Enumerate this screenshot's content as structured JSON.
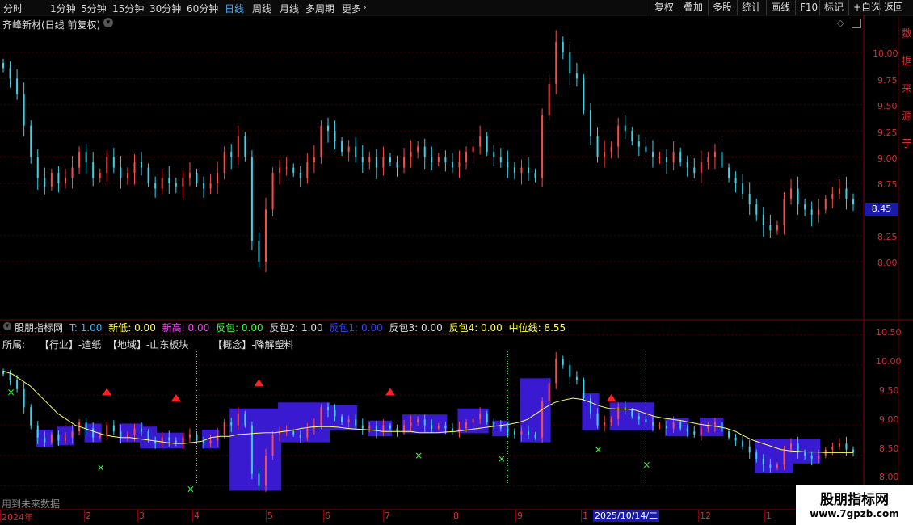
{
  "toolbar": {
    "timeframes": [
      "分时",
      "1分钟",
      "5分钟",
      "15分钟",
      "30分钟",
      "60分钟",
      "日线",
      "周线",
      "月线",
      "多周期",
      "更多"
    ],
    "active": "日线",
    "right_buttons": [
      "复权",
      "叠加",
      "多股",
      "统计",
      "画线",
      "F10",
      "标记",
      "+自选",
      "返回"
    ]
  },
  "main": {
    "title": "齐峰新材(日线 前复权)",
    "price_labels": [
      "10.00",
      "9.75",
      "9.50",
      "9.25",
      "9.00",
      "8.75",
      "8.25",
      "8.00"
    ],
    "current_price": "8.45",
    "right_edge_text": "数据来源于"
  },
  "indicator": {
    "name": "股朋指标网",
    "values": [
      {
        "label": "T: 1.00",
        "color": "#33b8ff"
      },
      {
        "label": "新低: 0.00",
        "color": "#ffff44"
      },
      {
        "label": "新高: 0.00",
        "color": "#ff44ff"
      },
      {
        "label": "反包: 0.00",
        "color": "#33ff33"
      },
      {
        "label": "反包2: 1.00",
        "color": "#dddddd"
      },
      {
        "label": "反包1: 0.00",
        "color": "#3344ff"
      },
      {
        "label": "反包3: 0.00",
        "color": "#dddddd"
      },
      {
        "label": "反包4: 0.00",
        "color": "#ffff44"
      },
      {
        "label": "中位线: 8.55",
        "color": "#ffff44"
      }
    ],
    "belong": "所属:",
    "industry": "【行业】-造纸",
    "region": "【地域】-山东板块",
    "concept": "【概念】-降解塑料",
    "price_labels": [
      "10.50",
      "10.00",
      "9.50",
      "9.00",
      "8.50",
      "8.00"
    ],
    "footnote": "用到未来数据"
  },
  "dates": {
    "labels": [
      "2024年",
      "2",
      "3",
      "4",
      "5",
      "6",
      "7",
      "8",
      "9",
      "1",
      "12",
      "1"
    ],
    "highlight": "2025/10/14/二"
  },
  "watermark": {
    "line1": "股朋指标网",
    "line2": "www.7gpzb.com"
  },
  "colors": {
    "up": "#ff4a4a",
    "down": "#3ad3e8",
    "ma": "#ffff66",
    "band": "#3a1ad0",
    "grid": "#4a0000"
  },
  "chart_data": [
    {
      "type": "candlestick",
      "title": "齐峰新材(日线 前复权)",
      "ylim": [
        7.5,
        10.2
      ],
      "yticks": [
        8.0,
        8.25,
        8.75,
        9.0,
        9.25,
        9.5,
        9.75,
        10.0
      ],
      "last_price": 8.45,
      "close": [
        9.85,
        9.75,
        9.6,
        9.3,
        9.0,
        8.8,
        8.72,
        8.85,
        8.75,
        8.8,
        8.9,
        9.05,
        8.95,
        8.8,
        8.85,
        9.0,
        8.9,
        8.8,
        8.85,
        8.95,
        8.9,
        8.75,
        8.7,
        8.8,
        8.75,
        8.72,
        8.8,
        8.85,
        8.75,
        8.7,
        8.75,
        8.85,
        9.05,
        9.0,
        9.2,
        9.0,
        8.2,
        8.0,
        8.5,
        8.85,
        8.9,
        8.9,
        8.85,
        8.8,
        8.95,
        9.0,
        9.3,
        9.25,
        9.15,
        9.05,
        9.1,
        9.0,
        8.95,
        9.0,
        8.9,
        9.0,
        8.95,
        8.9,
        9.0,
        9.05,
        9.1,
        9.0,
        8.95,
        9.0,
        8.95,
        8.9,
        8.95,
        9.05,
        9.1,
        9.2,
        9.05,
        9.0,
        8.95,
        8.9,
        8.85,
        8.9,
        8.85,
        8.8,
        9.4,
        9.7,
        10.1,
        10.0,
        9.8,
        9.75,
        9.45,
        9.2,
        9.0,
        9.05,
        9.1,
        9.3,
        9.25,
        9.15,
        9.1,
        9.05,
        9.0,
        9.0,
        8.95,
        9.05,
        8.95,
        8.9,
        8.85,
        8.95,
        9.0,
        9.05,
        8.9,
        8.8,
        8.75,
        8.65,
        8.55,
        8.45,
        8.35,
        8.3,
        8.35,
        8.6,
        8.7,
        8.55,
        8.5,
        8.45,
        8.5,
        8.6,
        8.65,
        8.7,
        8.6,
        8.55
      ]
    },
    {
      "type": "line",
      "title": "股朋指标网",
      "ylim": [
        7.9,
        10.6
      ],
      "yticks": [
        8.0,
        8.5,
        9.0,
        9.5,
        10.0,
        10.5
      ],
      "series": [
        {
          "name": "中位线",
          "values": [
            9.9,
            9.85,
            9.75,
            9.65,
            9.5,
            9.35,
            9.2,
            9.1,
            9.0,
            8.95,
            8.9,
            8.85,
            8.82,
            8.8,
            8.8,
            8.78,
            8.76,
            8.74,
            8.72,
            8.7,
            8.7,
            8.72,
            8.74,
            8.8,
            8.82,
            8.82,
            8.85,
            8.86,
            8.87,
            8.88,
            8.88,
            8.9,
            8.92,
            8.95,
            8.97,
            8.98,
            8.98,
            8.97,
            8.95,
            8.94,
            8.93,
            8.92,
            8.9,
            8.9,
            8.9,
            8.9,
            8.88,
            8.88,
            8.88,
            8.89,
            8.9,
            8.92,
            8.94,
            8.96,
            8.98,
            9.0,
            9.02,
            9.05,
            9.1,
            9.2,
            9.3,
            9.38,
            9.42,
            9.45,
            9.43,
            9.38,
            9.32,
            9.28,
            9.27,
            9.27,
            9.25,
            9.2,
            9.15,
            9.12,
            9.1,
            9.08,
            9.05,
            9.02,
            9.0,
            8.98,
            8.95,
            8.9,
            8.82,
            8.75,
            8.7,
            8.65,
            8.6,
            8.58,
            8.57,
            8.56,
            8.56,
            8.55,
            8.55,
            8.55,
            8.55
          ]
        }
      ],
      "up_markers": 4,
      "down_markers": 6
    }
  ]
}
